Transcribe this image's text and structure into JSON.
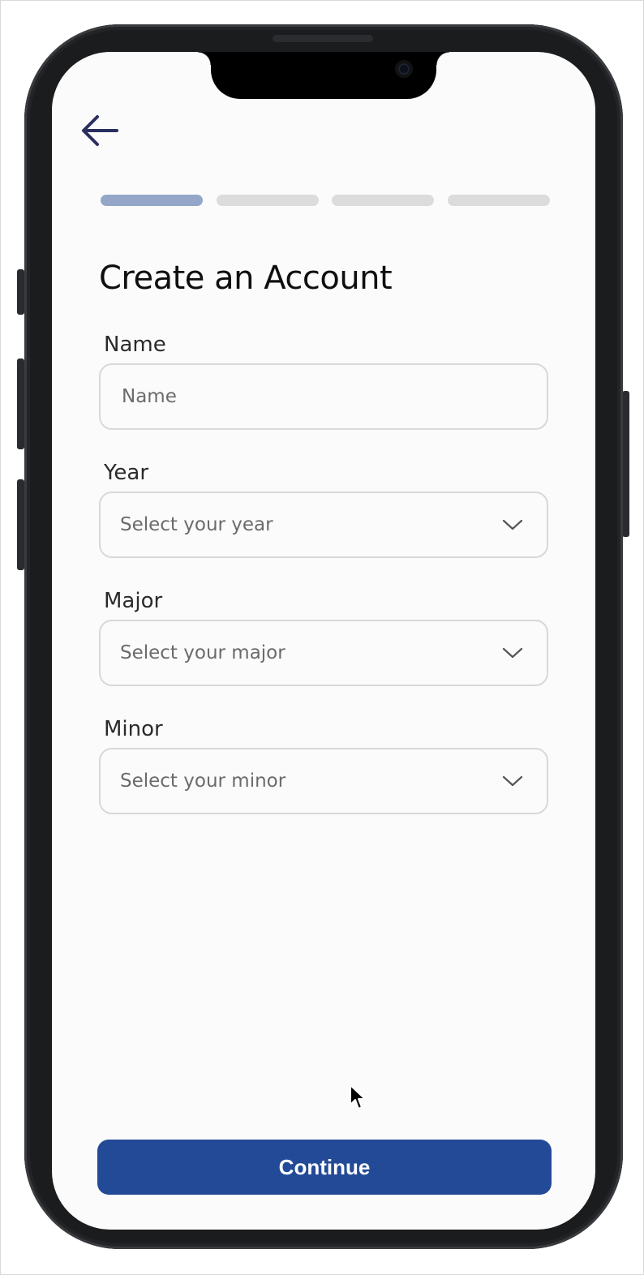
{
  "screen": {
    "title": "Create an Account",
    "progress": {
      "total_steps": 4,
      "current_step": 1,
      "active_color": "#94a7c9",
      "inactive_color": "#dcdcdc"
    },
    "back_icon": "arrow-left-icon"
  },
  "form": {
    "name": {
      "label": "Name",
      "placeholder": "Name"
    },
    "year": {
      "label": "Year",
      "placeholder": "Select your year"
    },
    "major": {
      "label": "Major",
      "placeholder": "Select your major"
    },
    "minor": {
      "label": "Minor",
      "placeholder": "Select your minor"
    }
  },
  "continue": {
    "label": "Continue",
    "color": "#234a97"
  },
  "colors": {
    "back_arrow": "#2a2f5e",
    "screen_bg": "#fbfbfb"
  }
}
